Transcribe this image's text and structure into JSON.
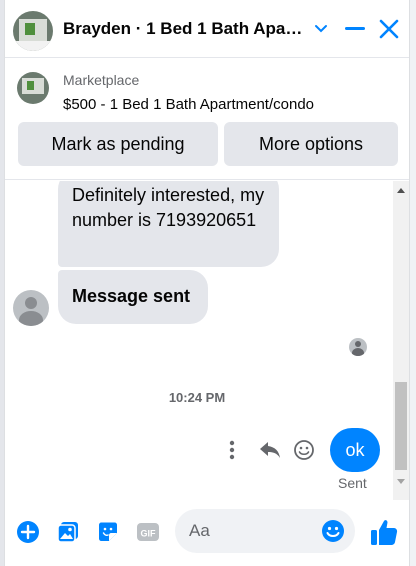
{
  "header": {
    "title": "Brayden · 1 Bed 1 Bath Apartment/condo",
    "icons": [
      "chevron-down-icon",
      "minimize-icon",
      "close-icon"
    ]
  },
  "marketplace": {
    "label": "Marketplace",
    "listing": "$500 - 1 Bed 1 Bath Apartment/condo",
    "mark_pending_label": "Mark as pending",
    "more_options_label": "More options"
  },
  "messages": [
    {
      "from": "other",
      "text": "Definitely interested, my number is 7193920651"
    },
    {
      "from": "other",
      "text": "Message sent"
    }
  ],
  "timestamp": "10:24 PM",
  "my_message": {
    "text": "ok",
    "status": "Sent"
  },
  "composer": {
    "placeholder": "Aa",
    "icons": [
      "plus-icon",
      "photo-icon",
      "sticker-icon",
      "gif-icon",
      "emoji-icon",
      "like-icon"
    ],
    "gif_label": "GIF"
  },
  "colors": {
    "accent": "#0084ff",
    "bubble_other": "#e4e6eb",
    "text_secondary": "#65676b"
  }
}
